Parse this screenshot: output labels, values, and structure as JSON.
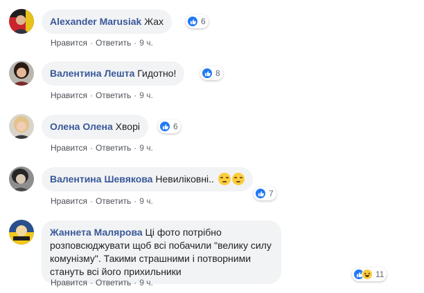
{
  "labels": {
    "like": "Нравится",
    "reply": "Ответить",
    "dot": "·"
  },
  "comments": [
    {
      "author": "Alexander Marusiak",
      "text": "Жах",
      "reactions": "6",
      "time": "9 ч."
    },
    {
      "author": "Валентина Лешта",
      "text": "Гидотно!",
      "reactions": "8",
      "time": "9 ч."
    },
    {
      "author": "Олена Олена",
      "text": "Хворі",
      "reactions": "6",
      "time": "9 ч."
    },
    {
      "author": "Валентина Шевякова",
      "text": "Невиліковні..",
      "reactions": "7",
      "time": "9 ч."
    },
    {
      "author": "Жаннета Малярова",
      "text": "Ці фото потрібно розповсюджувати щоб всі побачили \"велику силу комунізму\". Такими страшними і потворними стануть всі його прихильники",
      "reactions": "11",
      "time": "9 ч."
    }
  ],
  "colors": {
    "author": "#385898",
    "bubble": "#f2f3f5",
    "like": "#2078f4",
    "meta": "#606770"
  },
  "icons": [
    "like-icon",
    "haha-icon",
    "unamused-emoji-icon"
  ]
}
